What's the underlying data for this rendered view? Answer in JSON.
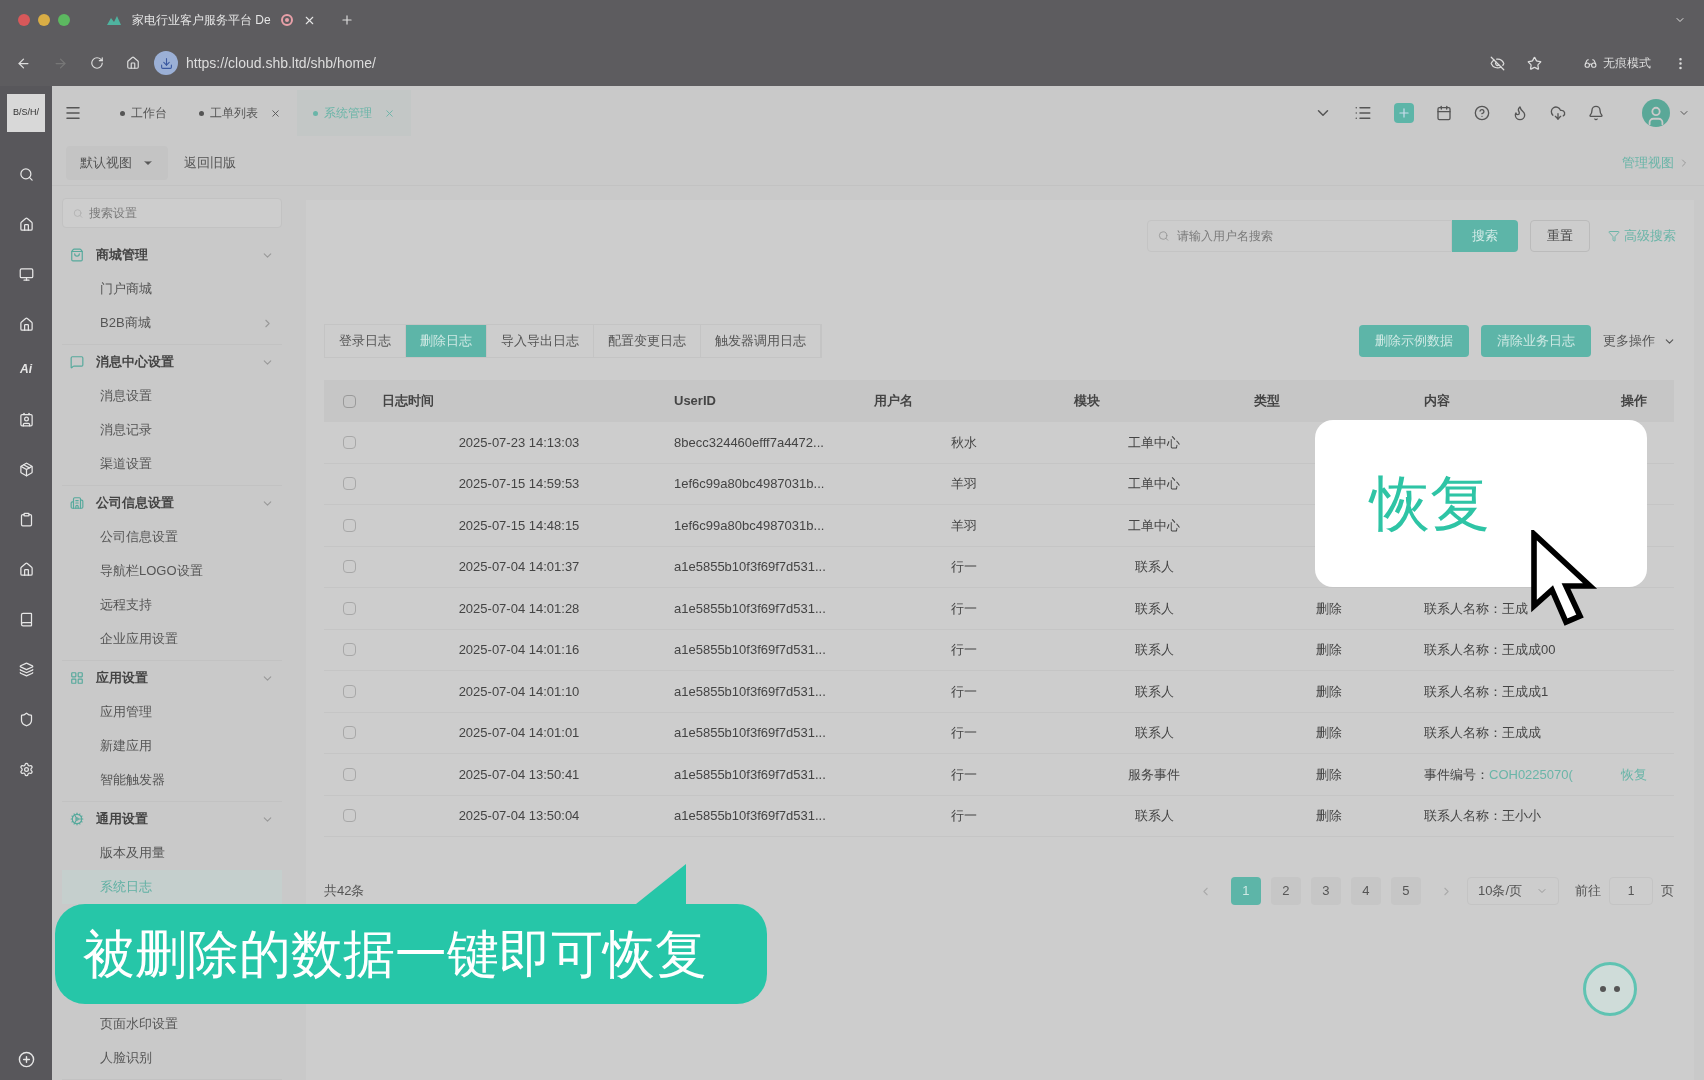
{
  "browser": {
    "tab_title": "家电行业客户服务平台 De",
    "url": "https://cloud.shb.ltd/shb/home/",
    "incognito_label": "无痕模式"
  },
  "rail": {
    "logo": "B/S/H/",
    "ai_label": "Ai"
  },
  "app_tabs": [
    {
      "label": "工作台",
      "selected": false,
      "closable": false
    },
    {
      "label": "工单列表",
      "selected": false,
      "closable": true
    },
    {
      "label": "系统管理",
      "selected": true,
      "closable": true
    }
  ],
  "subbar": {
    "view_select": "默认视图",
    "back_link": "返回旧版",
    "manage_view": "管理视图"
  },
  "sidebar": {
    "search_placeholder": "搜索设置",
    "groups": [
      {
        "title": "商城管理",
        "expanded": true,
        "items": [
          {
            "label": "门户商城",
            "selected": false,
            "has_children": false
          },
          {
            "label": "B2B商城",
            "selected": false,
            "has_children": true
          }
        ]
      },
      {
        "title": "消息中心设置",
        "expanded": true,
        "items": [
          {
            "label": "消息设置",
            "selected": false,
            "has_children": false
          },
          {
            "label": "消息记录",
            "selected": false,
            "has_children": false
          },
          {
            "label": "渠道设置",
            "selected": false,
            "has_children": false
          }
        ]
      },
      {
        "title": "公司信息设置",
        "expanded": true,
        "items": [
          {
            "label": "公司信息设置",
            "selected": false,
            "has_children": false
          },
          {
            "label": "导航栏LOGO设置",
            "selected": false,
            "has_children": false
          },
          {
            "label": "远程支持",
            "selected": false,
            "has_children": false
          },
          {
            "label": "企业应用设置",
            "selected": false,
            "has_children": false
          }
        ]
      },
      {
        "title": "应用设置",
        "expanded": true,
        "items": [
          {
            "label": "应用管理",
            "selected": false,
            "has_children": false
          },
          {
            "label": "新建应用",
            "selected": false,
            "has_children": false
          },
          {
            "label": "智能触发器",
            "selected": false,
            "has_children": false
          }
        ]
      },
      {
        "title": "通用设置",
        "expanded": true,
        "items": [
          {
            "label": "版本及用量",
            "selected": false,
            "has_children": false
          },
          {
            "label": "系统日志",
            "selected": true,
            "has_children": false
          },
          {
            "label": "页面水印设置",
            "selected": false,
            "has_children": false
          },
          {
            "label": "人脸识别",
            "selected": false,
            "has_children": false
          }
        ]
      }
    ]
  },
  "search": {
    "placeholder": "请输入用户名搜索",
    "search_button": "搜索",
    "reset_button": "重置",
    "advanced": "高级搜索"
  },
  "log_tabs": [
    {
      "label": "登录日志",
      "selected": false
    },
    {
      "label": "删除日志",
      "selected": true
    },
    {
      "label": "导入导出日志",
      "selected": false
    },
    {
      "label": "配置变更日志",
      "selected": false
    },
    {
      "label": "触发器调用日志",
      "selected": false
    }
  ],
  "actions": [
    "删除示例数据",
    "清除业务日志"
  ],
  "more_actions": "更多操作",
  "table": {
    "select_all_checked": false,
    "columns": [
      "日志时间",
      "UserID",
      "用户名",
      "模块",
      "类型",
      "内容",
      "操作"
    ],
    "rows": [
      {
        "checked": false,
        "time": "2025-07-23 14:13:03",
        "user_id": "8becc324460efff7a4472...",
        "user": "秋水",
        "module": "工单中心"
      },
      {
        "checked": false,
        "time": "2025-07-15 14:59:53",
        "user_id": "1ef6c99a80bc4987031b...",
        "user": "羊羽",
        "module": "工单中心"
      },
      {
        "checked": false,
        "time": "2025-07-15 14:48:15",
        "user_id": "1ef6c99a80bc4987031b...",
        "user": "羊羽",
        "module": "工单中心"
      },
      {
        "checked": false,
        "time": "2025-07-04 14:01:37",
        "user_id": "a1e5855b10f3f69f7d531...",
        "user": "行一",
        "module": "联系人"
      },
      {
        "checked": false,
        "time": "2025-07-04 14:01:28",
        "user_id": "a1e5855b10f3f69f7d531...",
        "user": "行一",
        "module": "联系人",
        "type": "删除",
        "content": "联系人名称：王成"
      },
      {
        "checked": false,
        "time": "2025-07-04 14:01:16",
        "user_id": "a1e5855b10f3f69f7d531...",
        "user": "行一",
        "module": "联系人",
        "type": "删除",
        "content": "联系人名称：王成成00"
      },
      {
        "checked": false,
        "time": "2025-07-04 14:01:10",
        "user_id": "a1e5855b10f3f69f7d531...",
        "user": "行一",
        "module": "联系人",
        "type": "删除",
        "content": "联系人名称：王成成1"
      },
      {
        "checked": false,
        "time": "2025-07-04 14:01:01",
        "user_id": "a1e5855b10f3f69f7d531...",
        "user": "行一",
        "module": "联系人",
        "type": "删除",
        "content": "联系人名称：王成成"
      },
      {
        "checked": false,
        "time": "2025-07-04 13:50:41",
        "user_id": "a1e5855b10f3f69f7d531...",
        "user": "行一",
        "module": "服务事件",
        "type": "删除",
        "content": "事件编号：",
        "content_link": "COH0225070(",
        "action": "恢复"
      },
      {
        "checked": false,
        "time": "2025-07-04 13:50:04",
        "user_id": "a1e5855b10f3f69f7d531...",
        "user": "行一",
        "module": "联系人",
        "type": "删除",
        "content": "联系人名称：王小小"
      }
    ]
  },
  "pagination": {
    "total": "共42条",
    "pages": [
      {
        "label": "1",
        "selected": true
      },
      {
        "label": "2",
        "selected": false
      },
      {
        "label": "3",
        "selected": false
      },
      {
        "label": "4",
        "selected": false
      },
      {
        "label": "5",
        "selected": false
      }
    ],
    "page_size": "10条/页",
    "goto_label": "前往",
    "goto_value": "1",
    "page_unit": "页"
  },
  "popup": {
    "text": "恢复"
  },
  "caption": "被删除的数据一键即可恢复"
}
